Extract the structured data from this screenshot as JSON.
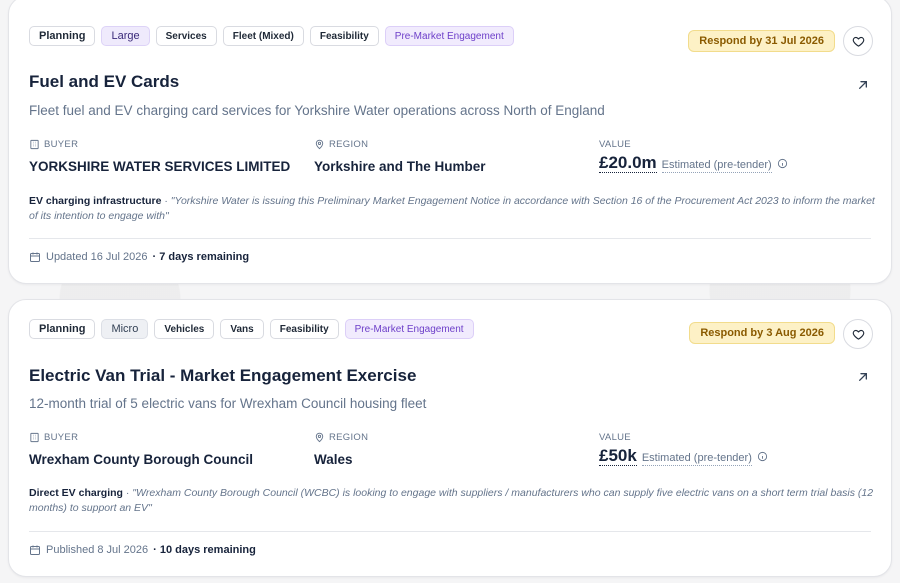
{
  "cards": [
    {
      "tags": [
        "Planning",
        "Large",
        "Services",
        "Fleet (Mixed)",
        "Feasibility",
        "Pre-Market Engagement"
      ],
      "deadline": "Respond by 31 Jul 2026",
      "title": "Fuel and EV Cards",
      "description": "Fleet fuel and EV charging card services for Yorkshire Water operations across North of England",
      "buyer_label": "BUYER",
      "buyer": "YORKSHIRE WATER SERVICES LIMITED",
      "region_label": "REGION",
      "region": "Yorkshire and The Humber",
      "value_label": "VALUE",
      "value": "£20.0m",
      "value_note": "Estimated (pre-tender)",
      "category": "EV charging infrastructure",
      "category_sep": "·",
      "quote": "\"Yorkshire Water is issuing this Preliminary Market Engagement Notice in accordance with Section 16 of the Procurement Act 2023 to inform the market of its intention to engage with\"",
      "footer_date": "Updated 16 Jul 2026",
      "footer_remaining": "· 7 days remaining"
    },
    {
      "tags": [
        "Planning",
        "Micro",
        "Vehicles",
        "Vans",
        "Feasibility",
        "Pre-Market Engagement"
      ],
      "deadline": "Respond by 3 Aug 2026",
      "title": "Electric Van Trial - Market Engagement Exercise",
      "description": "12-month trial of 5 electric vans for Wrexham Council housing fleet",
      "buyer_label": "BUYER",
      "buyer": "Wrexham County Borough Council",
      "region_label": "REGION",
      "region": "Wales",
      "value_label": "VALUE",
      "value": "£50k",
      "value_note": "Estimated (pre-tender)",
      "category": "Direct EV charging",
      "category_sep": "·",
      "quote": "\"Wrexham County Borough Council (WCBC) is looking to engage with suppliers / manufacturers who can supply five electric vans on a short term trial basis (12 months) to support an EV\"",
      "footer_date": "Published 8 Jul 2026",
      "footer_remaining": "· 10 days remaining"
    }
  ],
  "icons": {
    "favourite": "heart-icon",
    "open": "arrow-up-right-icon",
    "buyer": "building-icon",
    "region": "map-pin-icon",
    "info": "info-icon",
    "date": "calendar-icon"
  },
  "colors": {
    "deadline_bg": "#fdf1c6",
    "deadline_text": "#8a5a00",
    "pme_tag": "#6d3fc9",
    "title": "#17233b"
  }
}
